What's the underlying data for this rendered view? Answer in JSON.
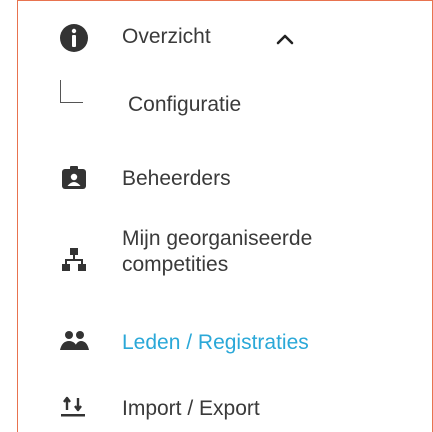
{
  "menu": {
    "overview": {
      "label": "Overzicht",
      "icon": "info-icon",
      "expanded": true
    },
    "configuration": {
      "label": "Configuratie"
    },
    "admins": {
      "label": "Beheerders",
      "icon": "badge-icon"
    },
    "competitions": {
      "label": "Mijn georganiseerde competities",
      "icon": "sitemap-icon"
    },
    "members": {
      "label": "Leden / Registraties",
      "icon": "people-icon",
      "active": true
    },
    "import_export": {
      "label": "Import / Export",
      "icon": "import-export-icon"
    }
  },
  "colors": {
    "text": "#3a3a3a",
    "icon": "#333333",
    "active": "#2aa8d8",
    "border": "#e8734f"
  }
}
